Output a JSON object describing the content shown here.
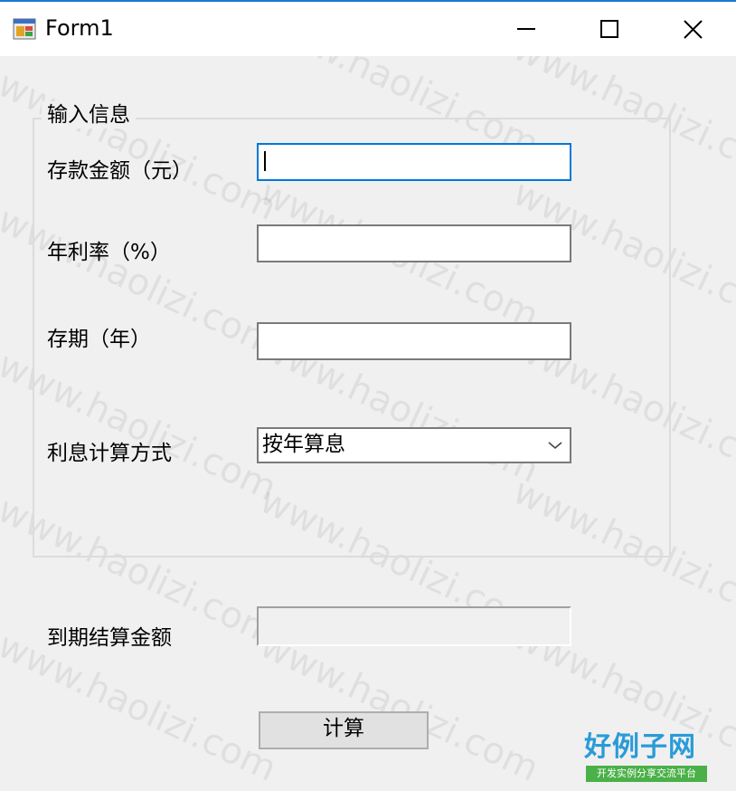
{
  "window": {
    "title": "Form1"
  },
  "group": {
    "label": "输入信息"
  },
  "fields": {
    "deposit_label": "存款金额（元）",
    "deposit_value": "",
    "rate_label": "年利率（%）",
    "rate_value": "",
    "term_label": "存期（年）",
    "term_value": "",
    "method_label": "利息计算方式",
    "method_value": "按年算息"
  },
  "result": {
    "label": "到期结算金额",
    "value": ""
  },
  "actions": {
    "calculate_label": "计算"
  },
  "watermark": {
    "text": "www.haolizi.com"
  },
  "logo": {
    "main": "好例子网",
    "sub": "开发实例分享交流平台"
  },
  "colors": {
    "accent": "#0078d7",
    "logo_blue": "#2a9bd8",
    "logo_green": "#4ab048"
  }
}
